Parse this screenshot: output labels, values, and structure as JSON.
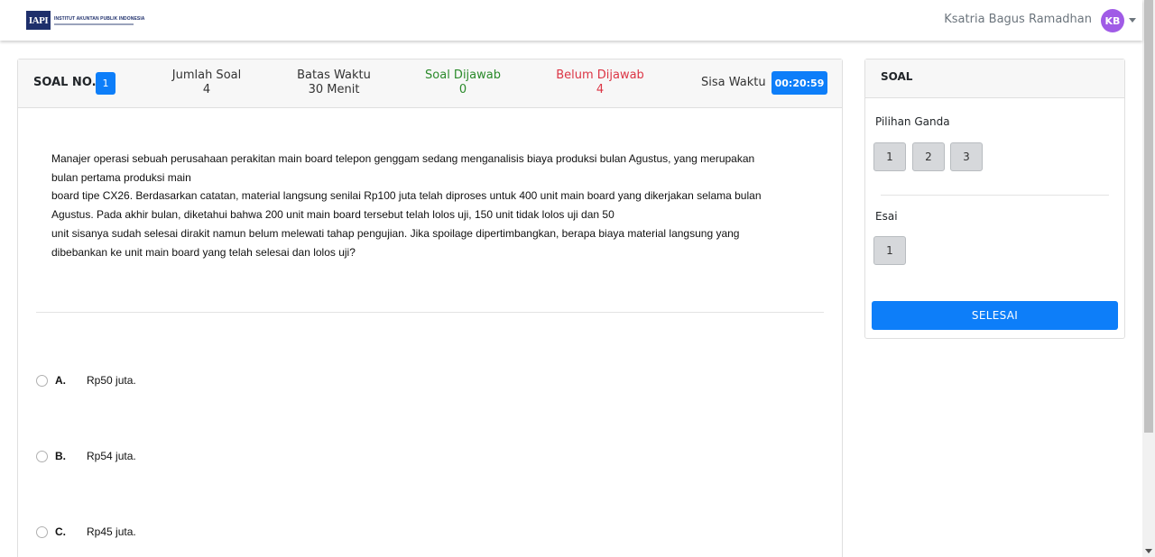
{
  "header": {
    "logo_abbr": "IAPI",
    "logo_title": "INSTITUT AKUNTAN PUBLIK INDONESIA",
    "user_name": "Ksatria Bagus Ramadhan",
    "avatar_initials": "KB"
  },
  "exam": {
    "soal_no_label": "SOAL NO.",
    "soal_no_value": "1",
    "jumlah_label": "Jumlah Soal",
    "jumlah_value": "4",
    "batas_label": "Batas Waktu",
    "batas_value": "30 Menit",
    "dijawab_label": "Soal Dijawab",
    "dijawab_value": "0",
    "belum_label": "Belum Dijawab",
    "belum_value": "4",
    "sisa_label": "Sisa Waktu",
    "timer": "00:20:59",
    "colors": {
      "accent": "#0d7ef9",
      "answered": "#2a8a2a",
      "unanswered": "#dc3545"
    }
  },
  "question": {
    "lines": [
      "Manajer operasi sebuah perusahaan perakitan main board telepon genggam sedang menganalisis biaya produksi bulan Agustus, yang merupakan",
      "bulan pertama produksi main",
      "board tipe CX26. Berdasarkan catatan, material langsung senilai Rp100 juta telah diproses untuk 400 unit main board yang dikerjakan selama bulan",
      "Agustus. Pada akhir bulan, diketahui bahwa 200 unit main board tersebut telah lolos uji, 150 unit tidak lolos uji dan 50",
      "unit sisanya sudah selesai dirakit namun belum melewati tahap pengujian. Jika spoilage dipertimbangkan, berapa biaya material langsung yang",
      "dibebankan ke unit main board yang telah selesai dan lolos uji?"
    ]
  },
  "options": [
    {
      "letter": "A.",
      "text": "Rp50 juta."
    },
    {
      "letter": "B.",
      "text": "Rp54 juta."
    },
    {
      "letter": "C.",
      "text": "Rp45 juta."
    }
  ],
  "sidebar": {
    "title": "SOAL",
    "pg_label": "Pilihan Ganda",
    "pg_buttons": [
      "1",
      "2",
      "3"
    ],
    "esai_label": "Esai",
    "esai_buttons": [
      "1"
    ],
    "finish_label": "SELESAI"
  }
}
